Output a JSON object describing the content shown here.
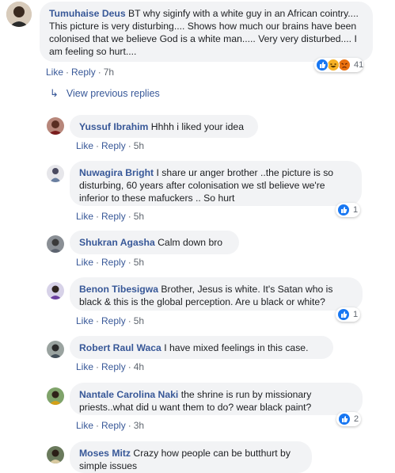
{
  "actions": {
    "like": "Like",
    "reply": "Reply",
    "dot": "·"
  },
  "main_comment": {
    "author": "Tumuhaise Deus",
    "text": "BT why siginfy with a white guy in an African cointry.... This picture is very disturbing.... Shows how much our brains have been colonised that we believe God is a white man..... Very very disturbed.... I am feeling so hurt....",
    "time": "7h",
    "reactions_count": "41",
    "reaction_icons": [
      "like-icon",
      "laugh-icon",
      "angry-icon"
    ]
  },
  "view_previous_replies": "View previous replies",
  "replies": [
    {
      "author": "Yussuf Ibrahim",
      "text": "Hhhh i liked your idea",
      "time": "5h",
      "likes": ""
    },
    {
      "author": "Nuwagira Bright",
      "text": "I share ur anger brother ..the picture is so disturbing, 60 years after colonisation we stl believe we're inferior to these mafuckers .. So hurt",
      "time": "5h",
      "likes": "1"
    },
    {
      "author": "Shukran Agasha",
      "text": "Calm down bro",
      "time": "5h",
      "likes": ""
    },
    {
      "author": "Benon Tibesigwa",
      "text": "Brother, Jesus is white. It's Satan who is black & this is the global perception. Are u black or white?",
      "time": "5h",
      "likes": "1"
    },
    {
      "author": "Robert Raul Waca",
      "text": "I have mixed feelings in this case.",
      "time": "4h",
      "likes": ""
    },
    {
      "author": "Nantale Carolina Naki",
      "text": "the shrine is run by missionary priests..what did u want them to do? wear black paint?",
      "time": "3h",
      "likes": "2"
    },
    {
      "author": "Moses Mitz",
      "text": "Crazy how people can be butthurt by simple issues",
      "time": "",
      "likes": ""
    }
  ],
  "colors": {
    "link": "#385898",
    "bubble": "#f2f3f5",
    "like_blue": "#1877f2",
    "laugh_yellow": "#f7b125",
    "angry_orange": "#e9710f"
  }
}
